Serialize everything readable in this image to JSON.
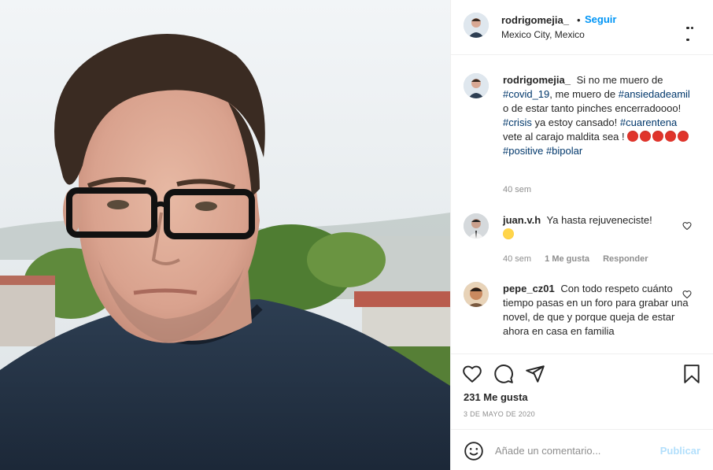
{
  "header": {
    "username": "rodrigomejia_",
    "separator": "•",
    "follow_label": "Seguir",
    "location": "Mexico City, Mexico",
    "more_icon": "more-horizontal-icon"
  },
  "caption": {
    "username": "rodrigomejia_",
    "text_1": "Si no me muero de",
    "tag_1": "#covid_19",
    "text_2": ", me muero de",
    "tag_2": "#ansiedadeamil",
    "text_3": "o de estar tanto pinches encerradoooo!",
    "tag_3": "#crisis",
    "text_4": "ya estoy cansado!",
    "tag_4": "#cuarentena",
    "text_5": "vete al carajo maldita sea !",
    "emoji": "angry-face-emoji",
    "tag_5": "#positive",
    "tag_6": "#bipolar",
    "time": "40 sem"
  },
  "comments": [
    {
      "username": "juan.v.h",
      "text": "Ya hasta rejuveneciste!",
      "emoji": "grinning-face-emoji",
      "time": "40 sem",
      "likes": "1 Me gusta",
      "reply": "Responder"
    },
    {
      "username": "pepe_cz01",
      "text": "Con todo respeto cuánto tiempo pasas en un foro para grabar una novel, de que y porque queja de estar ahora en casa en familia"
    }
  ],
  "actions": {
    "like_icon": "heart-icon",
    "comment_icon": "comment-icon",
    "share_icon": "paper-plane-icon",
    "save_icon": "bookmark-icon"
  },
  "likes": "231 Me gusta",
  "date": "3 DE MAYO DE 2020",
  "composer": {
    "placeholder": "Añade un comentario...",
    "post_label": "Publicar",
    "emoji_icon": "smiley-icon"
  },
  "colors": {
    "accent": "#0095f6",
    "hashtag": "#00376b",
    "muted": "#8e8e8e",
    "post_disabled": "#b2dffc"
  }
}
